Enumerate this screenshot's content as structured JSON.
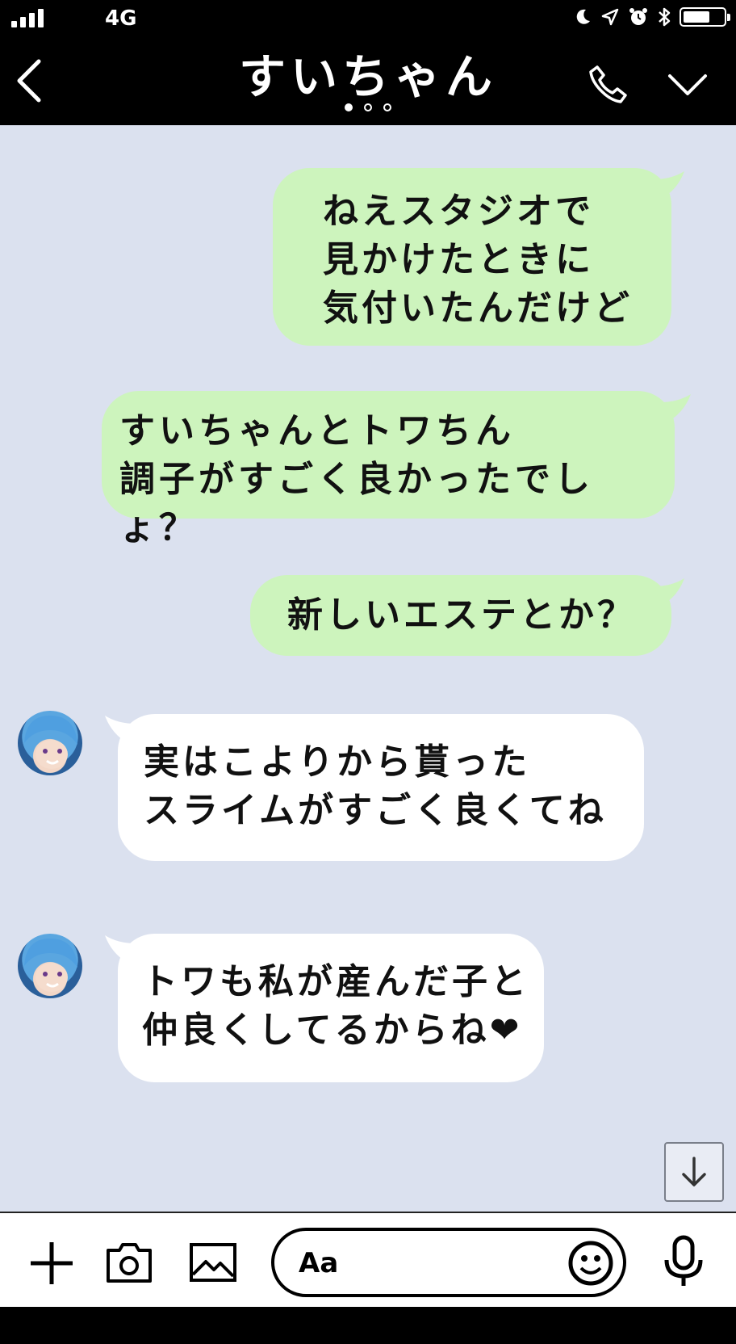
{
  "status_bar": {
    "network": "4G"
  },
  "header": {
    "title": "すいちゃん"
  },
  "messages": [
    {
      "side": "sent",
      "text": "ねえスタジオで\n見かけたときに\n気付いたんだけど"
    },
    {
      "side": "sent",
      "text": "すいちゃんとトワちん\n調子がすごく良かったでしょ？"
    },
    {
      "side": "sent",
      "text": "新しいエステとか？"
    },
    {
      "side": "received",
      "text": "実はこよりから貰った\nスライムがすごく良くてね"
    },
    {
      "side": "received",
      "text": "トワも私が産んだ子と\n仲良くしてるからね❤"
    }
  ],
  "input": {
    "placeholder": "Aa"
  },
  "colors": {
    "header_bg": "#000000",
    "chat_bg": "#dbe1ef",
    "sent_bubble": "#cdf4bd",
    "received_bubble": "#ffffff"
  },
  "icons": [
    "back-icon",
    "phone-icon",
    "chevron-down-icon",
    "plus-icon",
    "camera-icon",
    "image-icon",
    "emoji-icon",
    "mic-icon",
    "arrow-down-icon"
  ]
}
